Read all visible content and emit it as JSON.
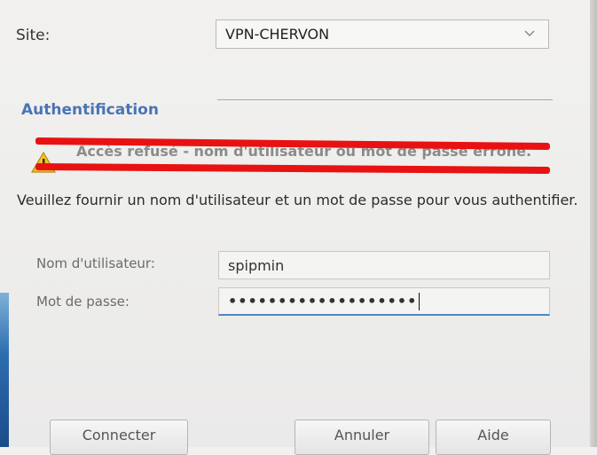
{
  "site": {
    "label": "Site:",
    "selected": "VPN-CHERVON"
  },
  "auth": {
    "section_title": "Authentification",
    "error_message": "Accès refusé - nom d'utilisateur ou mot de passe erroné.",
    "instructions": "Veuillez fournir un nom d'utilisateur et un mot de passe pour vous authentifier."
  },
  "form": {
    "username_label": "Nom d'utilisateur:",
    "username_value": "spipmin",
    "password_label": "Mot de passe:",
    "password_value": "•••••••••••••••••••"
  },
  "buttons": {
    "connect": "Connecter",
    "cancel": "Annuler",
    "help": "Aide"
  },
  "icons": {
    "select_arrow": "chevron-down-icon",
    "warning": "warning-icon"
  },
  "colors": {
    "section_title": "#4a74b4",
    "redaction": "#e81212",
    "warning_fill": "#f2c12e",
    "focus_border": "#4f86c6"
  }
}
